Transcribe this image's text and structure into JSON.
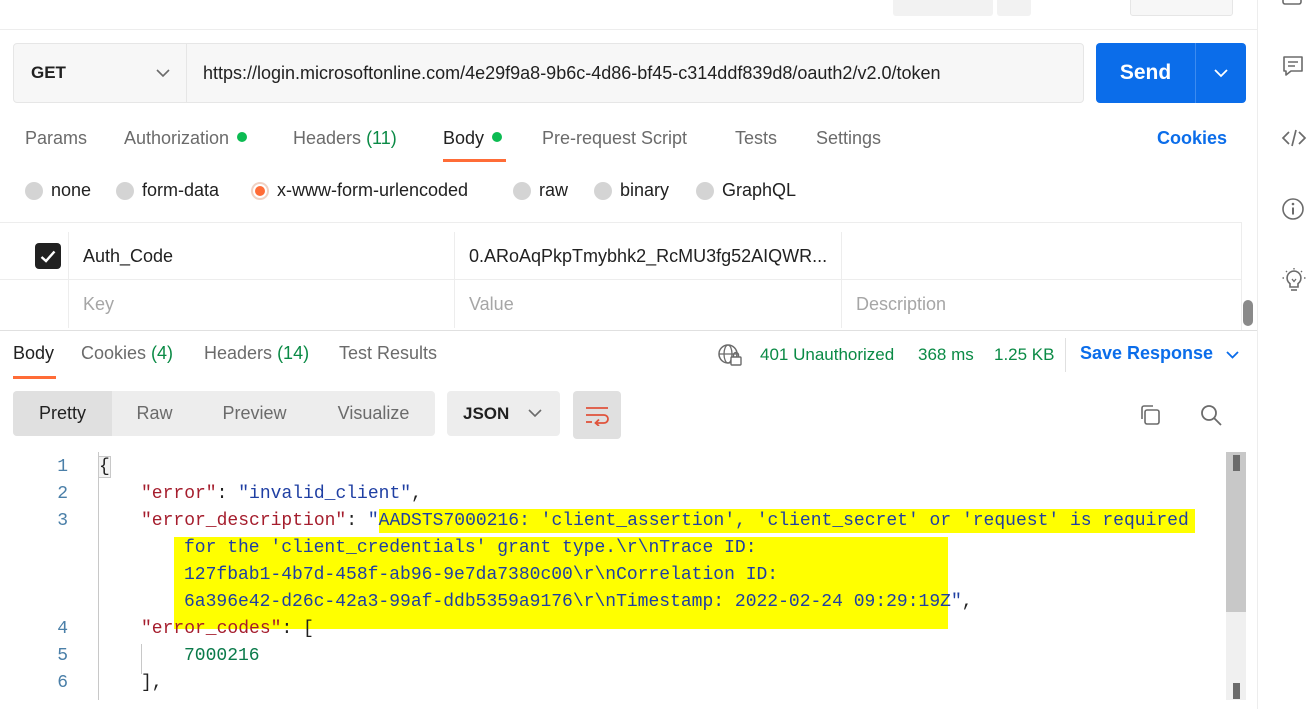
{
  "request": {
    "method": "GET",
    "url": "https://login.microsoftonline.com/4e29f9a8-9b6c-4d86-bf45-c314ddf839d8/oauth2/v2.0/token",
    "send_label": "Send"
  },
  "request_tabs": {
    "params": "Params",
    "authorization": "Authorization",
    "headers": "Headers",
    "headers_count": "(11)",
    "body": "Body",
    "prerequest": "Pre-request Script",
    "tests": "Tests",
    "settings": "Settings",
    "cookies": "Cookies"
  },
  "body_types": {
    "none": "none",
    "form_data": "form-data",
    "urlencoded": "x-www-form-urlencoded",
    "raw": "raw",
    "binary": "binary",
    "graphql": "GraphQL",
    "selected": "x-www-form-urlencoded"
  },
  "params": {
    "rows": [
      {
        "checked": true,
        "key": "Auth_Code",
        "value": "0.ARoAqPkpTmybhk2_RcMU3fg52AIQWR...",
        "description": ""
      }
    ],
    "placeholder": {
      "key": "Key",
      "value": "Value",
      "description": "Description"
    }
  },
  "response": {
    "tabs": {
      "body": "Body",
      "cookies": "Cookies",
      "cookies_count": "(4)",
      "headers": "Headers",
      "headers_count": "(14)",
      "test_results": "Test Results"
    },
    "status": "401 Unauthorized",
    "time": "368 ms",
    "size": "1.25 KB",
    "save_label": "Save Response",
    "views": {
      "pretty": "Pretty",
      "raw": "Raw",
      "preview": "Preview",
      "visualize": "Visualize"
    },
    "format": "JSON",
    "line_numbers": [
      "1",
      "2",
      "3",
      "4",
      "5",
      "6"
    ],
    "code": {
      "l1": "{",
      "error_key": "\"error\"",
      "error_val": "\"invalid_client\"",
      "desc_key": "\"error_description\"",
      "desc_quote": "\"",
      "desc_1": "AADSTS7000216: 'client_assertion', 'client_secret' or 'request' is required",
      "desc_2": "for the 'client_credentials' grant type.\\r\\nTrace ID:",
      "desc_3": "127fbab1-4b7d-458f-ab96-9e7da7380c00\\r\\nCorrelation ID:",
      "desc_4": "6a396e42-d26c-42a3-99af-ddb5359a9176\\r\\nTimestamp: 2022-02-24 09:29:19Z",
      "codes_key": "\"error_codes\"",
      "code_value": "7000216",
      "l6": "],"
    }
  },
  "colors": {
    "accent": "#ff6c37",
    "primary": "#0b6dea",
    "success": "#0a8a45",
    "highlight": "#ffff00"
  }
}
